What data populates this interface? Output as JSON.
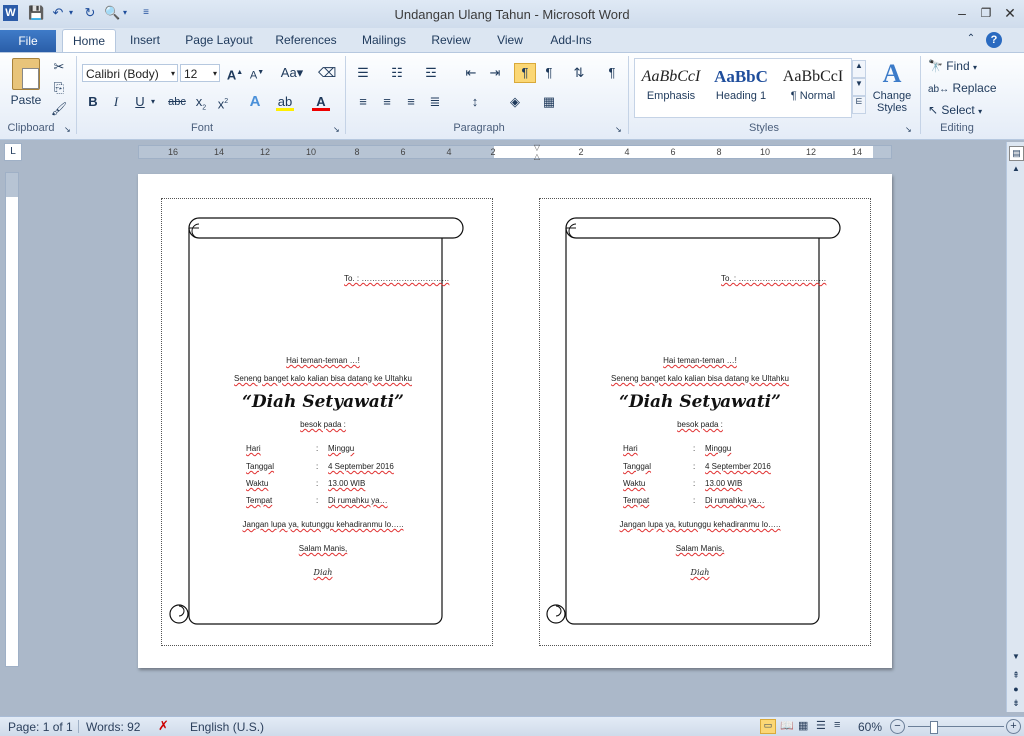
{
  "window": {
    "title": "Undangan Ulang Tahun - Microsoft Word"
  },
  "tabs": [
    "File",
    "Home",
    "Insert",
    "Page Layout",
    "References",
    "Mailings",
    "Review",
    "View",
    "Add-Ins"
  ],
  "clipboard": {
    "paste": "Paste",
    "label": "Clipboard"
  },
  "font": {
    "name": "Calibri (Body)",
    "size": "12",
    "label": "Font"
  },
  "paragraph": {
    "label": "Paragraph"
  },
  "styles": {
    "label": "Styles",
    "items": [
      {
        "sample": "AaBbCcI",
        "name": "Emphasis"
      },
      {
        "sample": "AaBbC",
        "name": "Heading 1"
      },
      {
        "sample": "AaBbCcI",
        "name": "¶ Normal"
      }
    ],
    "change": "Change Styles"
  },
  "editing": {
    "label": "Editing",
    "find": "Find",
    "replace": "Replace",
    "select": "Select"
  },
  "ruler": {
    "numbers": [
      "16",
      "14",
      "12",
      "10",
      "8",
      "6",
      "4",
      "2",
      "2",
      "4",
      "6",
      "8",
      "10",
      "12",
      "14"
    ]
  },
  "invitation": {
    "to": "To. : ……………………………",
    "greeting": "Hai teman-teman …!",
    "line1": "Seneng banget kalo kalian bisa datang ke Ultahku",
    "name": "“Diah Setyawati”",
    "besok": "besok pada :",
    "details": [
      {
        "label": "Hari",
        "value": "Minggu"
      },
      {
        "label": "Tanggal",
        "value": "4 September  2016"
      },
      {
        "label": "Waktu",
        "value": "13.00 WIB"
      },
      {
        "label": "Tempat",
        "value": "Di rumahku ya…"
      }
    ],
    "closing": "Jangan lupa ya, kutunggu kehadiranmu lo…..",
    "salam": "Salam Manis,",
    "signature": "Diah"
  },
  "status": {
    "page": "Page: 1 of 1",
    "words": "Words: 92",
    "language": "English (U.S.)",
    "zoom": "60%"
  }
}
